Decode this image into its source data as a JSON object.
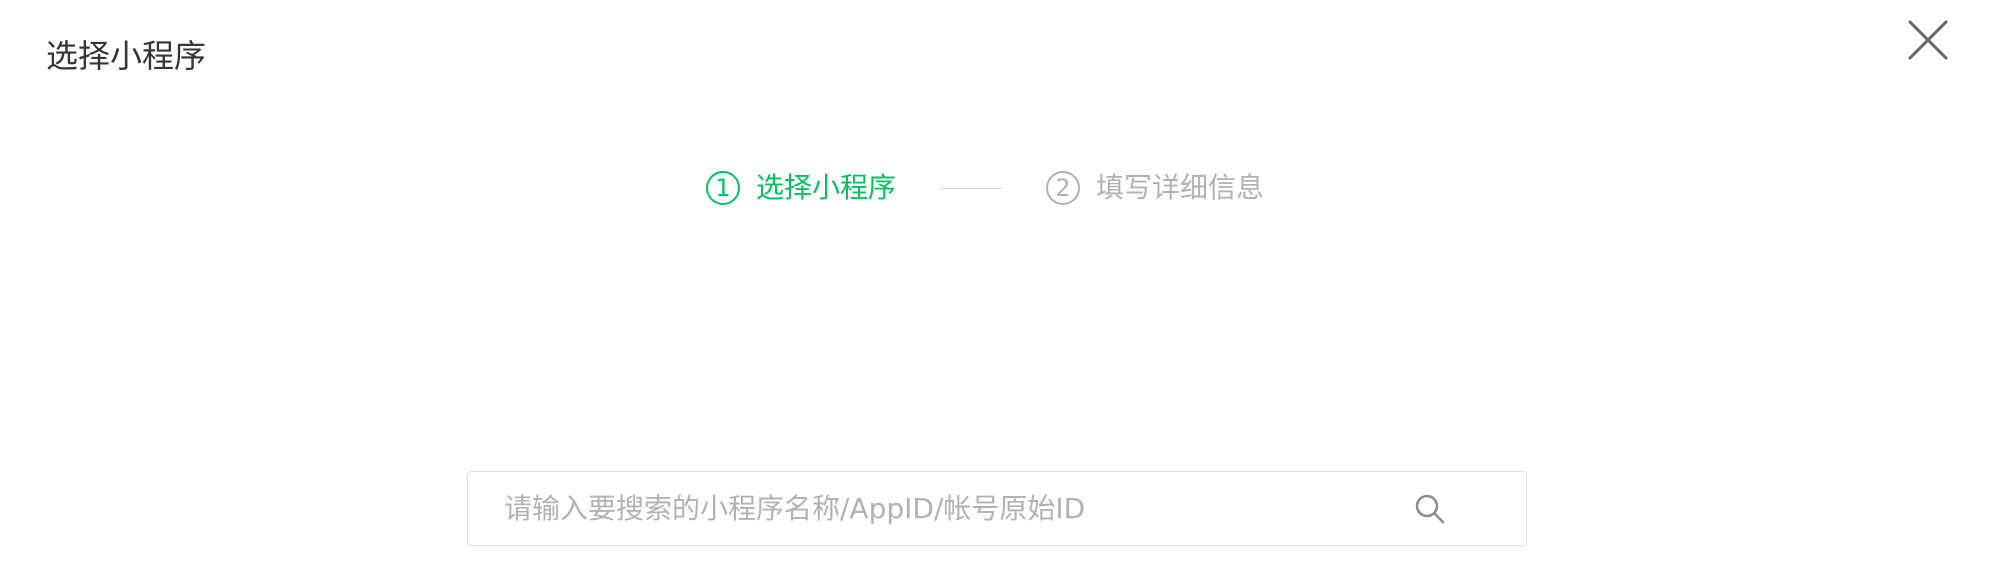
{
  "dialog": {
    "title": "选择小程序",
    "close_icon": "close-icon"
  },
  "steps": [
    {
      "number": "1",
      "label": "选择小程序",
      "state": "active"
    },
    {
      "number": "2",
      "label": "填写详细信息",
      "state": "inactive"
    }
  ],
  "search": {
    "value": "",
    "placeholder": "请输入要搜索的小程序名称/AppID/帐号原始ID",
    "icon": "search-icon"
  },
  "colors": {
    "accent": "#07c160",
    "inactive": "#b2b2b2",
    "title_text": "#353535",
    "border": "#e0e0e0"
  }
}
